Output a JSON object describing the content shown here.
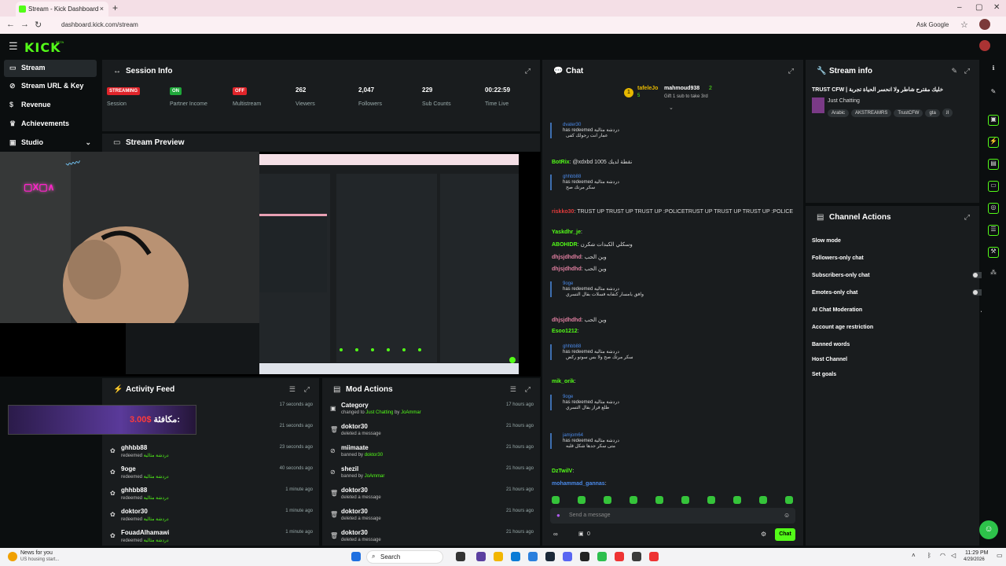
{
  "browser": {
    "tab_title": "Stream - Kick Dashboard",
    "tab_close": "×",
    "new_tab": "+",
    "url": "dashboard.kick.com/stream",
    "ask_google": "Ask Google",
    "win_min": "–",
    "win_max": "▢",
    "win_close": "✕"
  },
  "app": {
    "logo": "KICK",
    "logo_suffix": "BETA"
  },
  "sidebar": {
    "items": [
      {
        "label": "Stream",
        "icon": "broadcast-icon"
      },
      {
        "label": "Stream URL & Key",
        "icon": "link-icon"
      },
      {
        "label": "Revenue",
        "icon": "dollar-icon"
      },
      {
        "label": "Achievements",
        "icon": "trophy-icon"
      },
      {
        "label": "Studio",
        "icon": "studio-icon"
      }
    ]
  },
  "session": {
    "title": "Session Info",
    "stats": [
      {
        "badge": "STREAMING",
        "label": "Session",
        "color": "#e0242a"
      },
      {
        "badge": "ON",
        "label": "Partner Income",
        "color": "#1fa83a"
      },
      {
        "badge": "OFF",
        "label": "Multistream",
        "color": "#e0242a"
      },
      {
        "value": "262",
        "label": "Viewers"
      },
      {
        "value": "2,047",
        "label": "Followers"
      },
      {
        "value": "229",
        "label": "Sub Counts"
      },
      {
        "value": "00:22:59",
        "label": "Time Live"
      }
    ]
  },
  "preview": {
    "title": "Stream Preview"
  },
  "activity": {
    "title": "Activity Feed",
    "bonus_text": "مكافئة:",
    "bonus_amount": "3.00$",
    "rows": [
      {
        "who": "",
        "what": "",
        "when": "17 seconds ago"
      },
      {
        "who": "",
        "what": "redeemed",
        "when": "21 seconds ago"
      },
      {
        "who": "ghhbb88",
        "what": "redeemed",
        "reward": "دردشة مثالية",
        "when": "23 seconds ago"
      },
      {
        "who": "9oge",
        "what": "redeemed",
        "reward": "دردشة مثالية",
        "when": "40 seconds ago"
      },
      {
        "who": "ghhbb88",
        "what": "redeemed",
        "reward": "دردشة مثالية",
        "when": "1 minute ago"
      },
      {
        "who": "doktor30",
        "what": "redeemed",
        "reward": "دردشة مثالية",
        "when": "1 minute ago"
      },
      {
        "who": "FouadAlhamawi",
        "what": "redeemed",
        "reward": "دردشة مثالية",
        "when": "1 minute ago"
      }
    ]
  },
  "mod": {
    "title": "Mod Actions",
    "rows": [
      {
        "who": "Category",
        "what": "changed to",
        "target": "Just Chatting",
        "by": "by",
        "actor": "JoAmmar",
        "when": "17 hours ago",
        "icon": "category-icon"
      },
      {
        "who": "doktor30",
        "what": "deleted a message",
        "when": "21 hours ago",
        "icon": "trash-icon"
      },
      {
        "who": "miimaate",
        "what": "banned by",
        "actor": "doktor30",
        "when": "21 hours ago",
        "icon": "ban-icon"
      },
      {
        "who": "shezil",
        "what": "banned by",
        "actor": "JoAmmar",
        "when": "21 hours ago",
        "icon": "ban-icon"
      },
      {
        "who": "doktor30",
        "what": "deleted a message",
        "when": "21 hours ago",
        "icon": "trash-icon"
      },
      {
        "who": "doktor30",
        "what": "deleted a message",
        "when": "21 hours ago",
        "icon": "trash-icon"
      },
      {
        "who": "doktor30",
        "what": "deleted a message",
        "when": "21 hours ago",
        "icon": "trash-icon"
      }
    ]
  },
  "chat": {
    "title": "Chat",
    "pinned_user1": "tafeleJo",
    "pinned_count1": "5",
    "pinned_rank": "1",
    "pinned_user2": "mahmoud938",
    "pinned_count2": "2",
    "pinned_sub": "Gift 1 sub to take 3rd",
    "messages": [
      {
        "type": "redeem",
        "user": "dvater30",
        "action": "has redeemed",
        "reward": "دردشة مثالية",
        "reply": "عمار انت رجولك كفى"
      },
      {
        "type": "msg",
        "user": "BotRix",
        "text": "@xdxbd 1005 نقطة لديك"
      },
      {
        "type": "redeem",
        "user": "ghhbb88",
        "action": "has redeemed",
        "reward": "دردشة مثالية",
        "reply": "سكر مرتك صح"
      },
      {
        "type": "msg",
        "user": "riskko30",
        "text": "TRUST UP  TRUST UP  TRUST UP  :POLICETRUST UP  TRUST UP  TRUST UP  :POLICE"
      },
      {
        "type": "msg",
        "user": "Yaskdhr_je",
        "text": ""
      },
      {
        "type": "msg",
        "user": "ABOHIDR",
        "text": "وسكلي الكبدات شكرن"
      },
      {
        "type": "msg",
        "user": "dhjsjdhdhd",
        "text": "وين الحب"
      },
      {
        "type": "msg",
        "user": "dhjsjdhdhd",
        "text": "وين الحب"
      },
      {
        "type": "redeem",
        "user": "9oge",
        "action": "has redeemed",
        "reward": "دردشة مثالية",
        "reply": "وافق يامسار كنقابه فسلات بقال التسري"
      },
      {
        "type": "msg",
        "user": "dhjsjdhdhd",
        "text": "وين الحب"
      },
      {
        "type": "msg",
        "user": "Esoo1212",
        "text": ""
      },
      {
        "type": "redeem",
        "user": "ghhbb88",
        "action": "has redeemed",
        "reward": "دردشة مثالية",
        "reply": "سكر مرتك صح ولا بس سوتو ركض"
      },
      {
        "type": "msg",
        "user": "mik_orik",
        "text": ""
      },
      {
        "type": "redeem",
        "user": "9oge",
        "action": "has redeemed",
        "reward": "دردشة مثالية",
        "reply": "طلع فراز بقال التسري"
      },
      {
        "type": "redeem",
        "user": "jamjom64",
        "action": "has redeemed",
        "reward": "دردشة مثالية",
        "reply": "متى سكر جدها شكل قلبه"
      },
      {
        "type": "msg",
        "user": "DzTwilV",
        "text": ""
      },
      {
        "type": "msg",
        "user": "mohammad_gannas",
        "text": ""
      }
    ],
    "send_placeholder": "Send a message",
    "send_button": "Chat",
    "viewer_icon_count": "0"
  },
  "streaminfo": {
    "title": "Stream info",
    "stream_title": "TRUST CFW | خليك مقترح شاطر ولا انحسر الحياة تجربة",
    "category": "Just Chatting",
    "tags": [
      "Arabic",
      "AKSTREAMRS",
      "TrustCFW",
      "gta",
      "ﺍﻟ"
    ]
  },
  "channel_actions": {
    "title": "Channel Actions",
    "rows": [
      {
        "label": "Slow mode",
        "control": "chevron"
      },
      {
        "label": "Followers-only chat",
        "control": "chevron"
      },
      {
        "label": "Subscribers-only chat",
        "control": "toggle"
      },
      {
        "label": "Emotes-only chat",
        "control": "toggle"
      },
      {
        "label": "AI Chat Moderation",
        "control": "external"
      },
      {
        "label": "Account age restriction",
        "control": "chevron"
      },
      {
        "label": "Banned words",
        "control": "chevron"
      },
      {
        "label": "Host Channel",
        "control": "none"
      },
      {
        "label": "Set goals",
        "control": "chevron"
      }
    ]
  },
  "taskbar": {
    "news_title": "News for you",
    "news_sub": "US housing start...",
    "search": "Search",
    "time": "11:29 PM",
    "date": "4/29/2026"
  },
  "colors": {
    "accent": "#53fc18",
    "panel": "#191c1e",
    "bg": "#0b0e0f"
  }
}
